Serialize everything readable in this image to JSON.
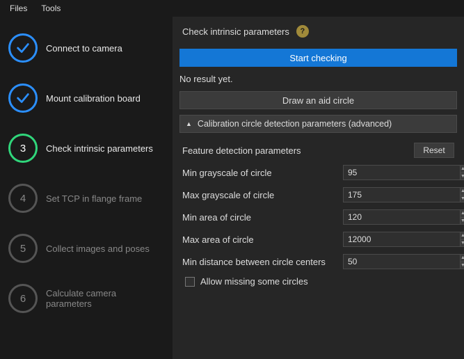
{
  "menu": {
    "files": "Files",
    "tools": "Tools"
  },
  "steps": [
    {
      "label": "Connect to camera",
      "state": "done",
      "num": ""
    },
    {
      "label": "Mount calibration board",
      "state": "done",
      "num": ""
    },
    {
      "label": "Check intrinsic parameters",
      "state": "active",
      "num": "3"
    },
    {
      "label": "Set TCP in flange frame",
      "state": "pending",
      "num": "4"
    },
    {
      "label": "Collect images and poses",
      "state": "pending",
      "num": "5"
    },
    {
      "label": "Calculate camera parameters",
      "state": "pending",
      "num": "6"
    }
  ],
  "header": {
    "title": "Check intrinsic parameters",
    "help_glyph": "?"
  },
  "actions": {
    "start": "Start checking",
    "status": "No result yet.",
    "aid": "Draw an aid circle"
  },
  "expander": {
    "label": "Calibration circle detection parameters (advanced)"
  },
  "panel": {
    "title": "Feature detection parameters",
    "reset": "Reset",
    "fields": {
      "min_gray": {
        "label": "Min grayscale of circle",
        "value": "95"
      },
      "max_gray": {
        "label": "Max grayscale of circle",
        "value": "175"
      },
      "min_area": {
        "label": "Min area of circle",
        "value": "120"
      },
      "max_area": {
        "label": "Max area of circle",
        "value": "12000"
      },
      "min_dist": {
        "label": "Min distance between circle centers",
        "value": "50"
      }
    },
    "allow_missing": "Allow missing some circles"
  }
}
